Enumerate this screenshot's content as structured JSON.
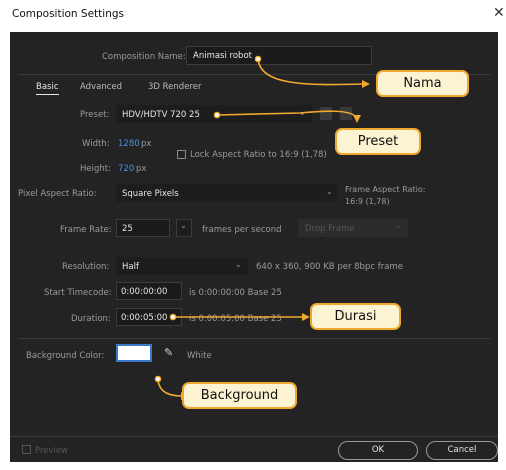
{
  "window": {
    "title": "Composition Settings"
  },
  "composition": {
    "name_label": "Composition Name:",
    "name_value": "Animasi robot"
  },
  "tabs": [
    {
      "label": "Basic",
      "active": true
    },
    {
      "label": "Advanced",
      "active": false
    },
    {
      "label": "3D Renderer",
      "active": false
    }
  ],
  "preset": {
    "label": "Preset:",
    "value": "HDV/HDTV 720 25"
  },
  "size": {
    "width_label": "Width:",
    "width_value": "1280",
    "width_unit": "px",
    "height_label": "Height:",
    "height_value": "720",
    "height_unit": "px",
    "lock_label": "Lock Aspect Ratio to 16:9 (1,78)"
  },
  "pixel_aspect": {
    "label": "Pixel Aspect Ratio:",
    "value": "Square Pixels",
    "frame_label": "Frame Aspect Ratio:",
    "frame_value": "16:9 (1,78)"
  },
  "frame_rate": {
    "label": "Frame Rate:",
    "value": "25",
    "unit": "frames per second",
    "drop": "Drop Frame"
  },
  "resolution": {
    "label": "Resolution:",
    "value": "Half",
    "info": "640 x 360, 900 KB per 8bpc frame"
  },
  "start_timecode": {
    "label": "Start Timecode:",
    "value": "0:00:00:00",
    "info": "is 0:00:00:00  Base 25"
  },
  "duration": {
    "label": "Duration:",
    "value": "0:00:05:00",
    "info": "is 0:00:05:00  Base 25"
  },
  "background": {
    "label": "Background Color:",
    "name": "White",
    "color": "#ffffff"
  },
  "footer": {
    "preview": "Preview",
    "ok": "OK",
    "cancel": "Cancel"
  },
  "annotations": {
    "nama": "Nama",
    "preset": "Preset",
    "durasi": "Durasi",
    "background": "Background"
  },
  "colors": {
    "accent": "#f0a92e",
    "callout_bg": "#fbf3d2",
    "link_blue": "#4a90e2"
  }
}
